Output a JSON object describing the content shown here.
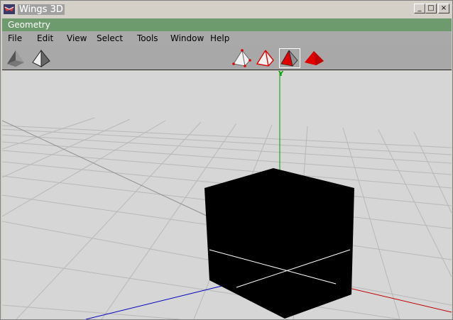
{
  "window": {
    "title": "Wings 3D",
    "controls": {
      "minimize": "_",
      "maximize": "□",
      "close": "×"
    }
  },
  "geometry_bar": {
    "label": "Geometry"
  },
  "menu": {
    "items": [
      {
        "label": "File"
      },
      {
        "label": "Edit"
      },
      {
        "label": "View"
      },
      {
        "label": "Select"
      },
      {
        "label": "Tools"
      },
      {
        "label": "Window"
      },
      {
        "label": "Help"
      }
    ]
  },
  "toolbar": {
    "left_tools": [
      {
        "icon": "smooth-shaded-icon"
      },
      {
        "icon": "wireframe-icon"
      }
    ],
    "selection_modes": [
      {
        "icon": "vertex-select-icon",
        "selected": false
      },
      {
        "icon": "edge-select-icon",
        "selected": false
      },
      {
        "icon": "face-select-icon",
        "selected": true
      },
      {
        "icon": "object-select-icon",
        "selected": false
      }
    ]
  },
  "viewport": {
    "axis_label_y": "Y",
    "colors": {
      "background": "#d6d6d6",
      "grid": "#b4b4b4",
      "cube": "#000000",
      "y_axis": "#00a000",
      "x_axis": "#c00000",
      "z_axis": "#0000c0"
    }
  }
}
